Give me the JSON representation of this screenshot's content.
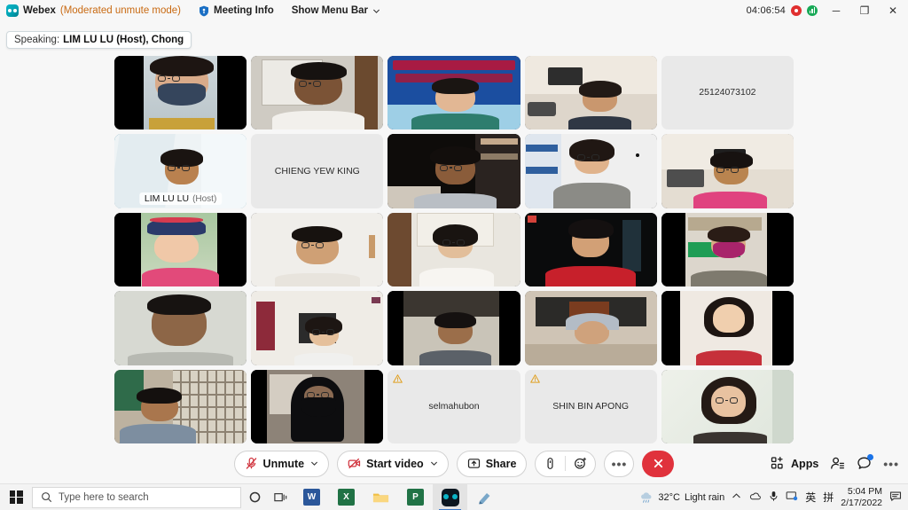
{
  "titlebar": {
    "app_name": "Webex",
    "mode": "(Moderated unmute mode)",
    "meeting_info_label": "Meeting Info",
    "show_menu_bar_label": "Show Menu Bar",
    "timer": "04:06:54",
    "recording_icon": "record-icon",
    "network_icon": "network-signal-icon",
    "minimize_label": "─",
    "maximize_label": "❐",
    "close_label": "✕"
  },
  "speaking": {
    "label": "Speaking:",
    "names": "LIM LU LU (Host), Chong"
  },
  "grid": {
    "tiles": [
      {
        "type": "video",
        "name": "",
        "scene": "woman-mask-glasses-dark"
      },
      {
        "type": "video",
        "name": "",
        "scene": "man-glasses-office"
      },
      {
        "type": "video",
        "name": "",
        "scene": "woman-banner-blue"
      },
      {
        "type": "video",
        "name": "",
        "scene": "woman-livingroom"
      },
      {
        "type": "placeholder",
        "name": "25124073102",
        "muted_warning": false
      },
      {
        "type": "video",
        "name": "LIM LU LU",
        "role": "(Host)",
        "active": true,
        "scene": "host-lightroom"
      },
      {
        "type": "placeholder",
        "name": "CHIENG YEW KING",
        "muted_warning": false
      },
      {
        "type": "video",
        "name": "",
        "scene": "woman-bookshelf"
      },
      {
        "type": "video",
        "name": "",
        "scene": "woman-grey-sweater"
      },
      {
        "type": "video",
        "name": "",
        "scene": "woman-pink-polo"
      },
      {
        "type": "video",
        "name": "",
        "scene": "woman-helmet-pink"
      },
      {
        "type": "video",
        "name": "",
        "scene": "man-white-wall"
      },
      {
        "type": "video",
        "name": "",
        "scene": "woman-white-shirt"
      },
      {
        "type": "video",
        "name": "",
        "scene": "woman-red-shirt-dark"
      },
      {
        "type": "video",
        "name": "",
        "scene": "woman-magenta-mask"
      },
      {
        "type": "video",
        "name": "",
        "scene": "man-plain-room"
      },
      {
        "type": "video",
        "name": "",
        "scene": "woman-home-red"
      },
      {
        "type": "video",
        "name": "",
        "scene": "man-dark-room"
      },
      {
        "type": "video",
        "name": "",
        "scene": "woman-hijab"
      },
      {
        "type": "video",
        "name": "",
        "scene": "woman-long-hair-red"
      },
      {
        "type": "video",
        "name": "",
        "scene": "man-window-room"
      },
      {
        "type": "video",
        "name": "",
        "scene": "woman-niqab-dark"
      },
      {
        "type": "placeholder",
        "name": "selmahubon",
        "muted_warning": true
      },
      {
        "type": "placeholder",
        "name": "SHIN BIN APONG",
        "muted_warning": true
      },
      {
        "type": "video",
        "name": "",
        "scene": "woman-glasses-bright"
      }
    ]
  },
  "controls": {
    "unmute_label": "Unmute",
    "unmute_icon": "microphone-muted-icon",
    "start_video_label": "Start video",
    "start_video_icon": "camera-off-icon",
    "share_label": "Share",
    "share_icon": "share-screen-icon",
    "attach_icon": "attachment-icon",
    "reaction_icon": "reaction-smiley-icon",
    "more_icon": "more-options-icon",
    "end_icon": "end-call-icon",
    "apps_label": "Apps",
    "apps_icon": "apps-grid-icon",
    "participants_icon": "participants-icon",
    "chat_icon": "chat-bubble-icon",
    "chat_has_notification": true,
    "right_more_icon": "more-options-icon"
  },
  "taskbar": {
    "start_icon": "windows-start-icon",
    "search_placeholder": "Type here to search",
    "search_icon": "search-icon",
    "cortana_icon": "cortana-icon",
    "taskview_icon": "task-view-icon",
    "apps": [
      {
        "name": "word",
        "label": "W",
        "color": "#2b579a"
      },
      {
        "name": "excel",
        "label": "X",
        "color": "#207245"
      },
      {
        "name": "file-explorer",
        "label": "",
        "color": "#f5c344"
      },
      {
        "name": "powerpoint",
        "label": "P",
        "color": "#217346"
      },
      {
        "name": "webex",
        "label": "",
        "color": "#0ab3c6",
        "active": true
      },
      {
        "name": "paint-app",
        "label": "",
        "color": "#7aa8c9"
      }
    ],
    "weather_temp": "32°C",
    "weather_desc": "Light rain",
    "weather_icon": "rain-cloud-icon",
    "tray_chevron": "chevron-up-icon",
    "tray_icons": [
      "onedrive-icon",
      "microphone-icon",
      "display-settings-icon"
    ],
    "ime_lang": "英",
    "ime_mode": "拼",
    "time": "5:04 PM",
    "date": "2/17/2022",
    "notification_icon": "notification-icon"
  },
  "colors": {
    "accent_blue": "#24a5d8",
    "end_red": "#e0323c",
    "mode_orange": "#c96a12",
    "record_red": "#e02f2f",
    "network_green": "#18a957",
    "background": "#f7f7f7"
  }
}
